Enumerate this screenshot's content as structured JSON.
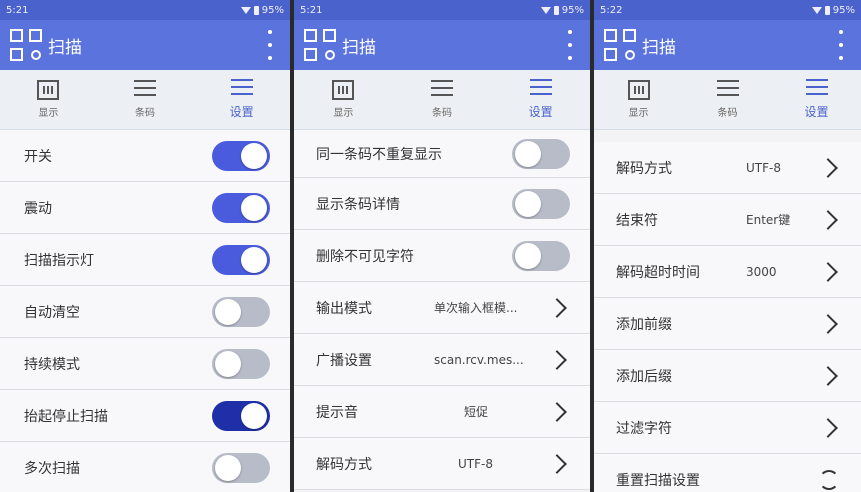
{
  "phones": [
    {
      "status_time": "5:21",
      "battery": "95%",
      "app_title": "扫描",
      "tabs": [
        {
          "label": "显示",
          "icon": "display-icon"
        },
        {
          "label": "条码",
          "icon": "barcode-list-icon"
        },
        {
          "label": "设置",
          "icon": "settings-sliders-icon"
        }
      ],
      "rows": [
        {
          "label": "开关",
          "switch": "on"
        },
        {
          "label": "震动",
          "switch": "on"
        },
        {
          "label": "扫描指示灯",
          "switch": "on"
        },
        {
          "label": "自动清空",
          "switch": "off"
        },
        {
          "label": "持续模式",
          "switch": "off"
        },
        {
          "label": "抬起停止扫描",
          "switch": "on"
        },
        {
          "label": "多次扫描",
          "switch": "off"
        }
      ]
    },
    {
      "status_time": "5:21",
      "battery": "95%",
      "app_title": "扫描",
      "tabs": [
        {
          "label": "显示",
          "icon": "display-icon"
        },
        {
          "label": "条码",
          "icon": "barcode-list-icon"
        },
        {
          "label": "设置",
          "icon": "settings-sliders-icon"
        }
      ],
      "rows": [
        {
          "label": "同一条码不重复显示",
          "switch": "off"
        },
        {
          "label": "显示条码详情",
          "switch": "off"
        },
        {
          "label": "删除不可见字符",
          "switch": "off"
        },
        {
          "label": "输出模式",
          "value": "单次输入框模..."
        },
        {
          "label": "广播设置",
          "value": "scan.rcv.mes..."
        },
        {
          "label": "提示音",
          "value": "短促"
        },
        {
          "label": "解码方式",
          "value": "UTF-8"
        }
      ]
    },
    {
      "status_time": "5:22",
      "battery": "95%",
      "app_title": "扫描",
      "tabs": [
        {
          "label": "显示",
          "icon": "display-icon"
        },
        {
          "label": "条码",
          "icon": "barcode-list-icon"
        },
        {
          "label": "设置",
          "icon": "settings-sliders-icon"
        }
      ],
      "rows": [
        {
          "label": "解码方式",
          "value": "UTF-8"
        },
        {
          "label": "结束符",
          "value": "Enter键"
        },
        {
          "label": "解码超时时间",
          "value": "3000"
        },
        {
          "label": "添加前缀",
          "value": ""
        },
        {
          "label": "添加后缀",
          "value": ""
        },
        {
          "label": "过滤字符",
          "value": ""
        },
        {
          "label": "重置扫描设置",
          "action": "reset"
        }
      ]
    }
  ],
  "colors": {
    "accent": "#5a73dd",
    "switch_on": "#4a5cdd",
    "switch_off": "#b8bcc8"
  }
}
